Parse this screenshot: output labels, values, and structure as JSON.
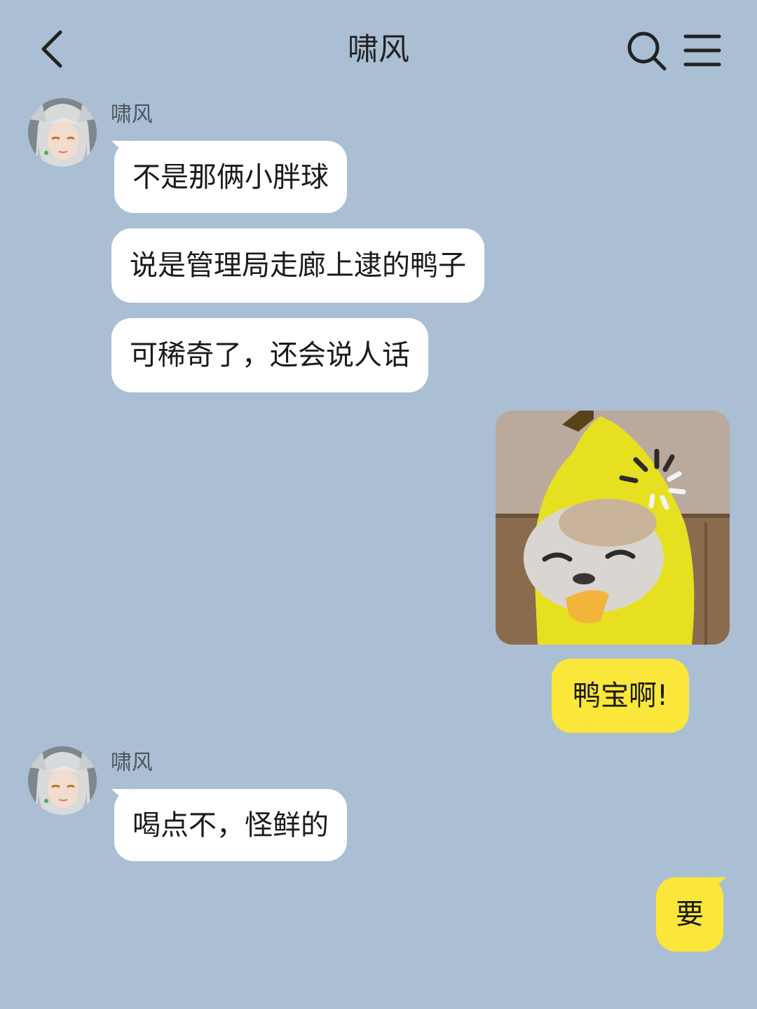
{
  "header": {
    "title": "啸风",
    "back_icon": "chevron-left-icon",
    "search_icon": "search-icon",
    "menu_icon": "menu-icon"
  },
  "colors": {
    "background": "#aabfd3",
    "incoming_bubble": "#ffffff",
    "outgoing_bubble": "#fbe63a"
  },
  "messages": [
    {
      "direction": "in",
      "sender": "啸风",
      "text": "不是那俩小胖球"
    },
    {
      "direction": "in",
      "text": "说是管理局走廊上逮的鸭子"
    },
    {
      "direction": "in",
      "text": "可稀奇了，还会说人话"
    },
    {
      "direction": "out",
      "type": "sticker",
      "sticker": "banana-cat-sticker"
    },
    {
      "direction": "out",
      "text": "鸭宝啊!"
    },
    {
      "direction": "in",
      "sender": "啸风",
      "text": "喝点不，怪鲜的"
    },
    {
      "direction": "out",
      "text": "要"
    }
  ]
}
